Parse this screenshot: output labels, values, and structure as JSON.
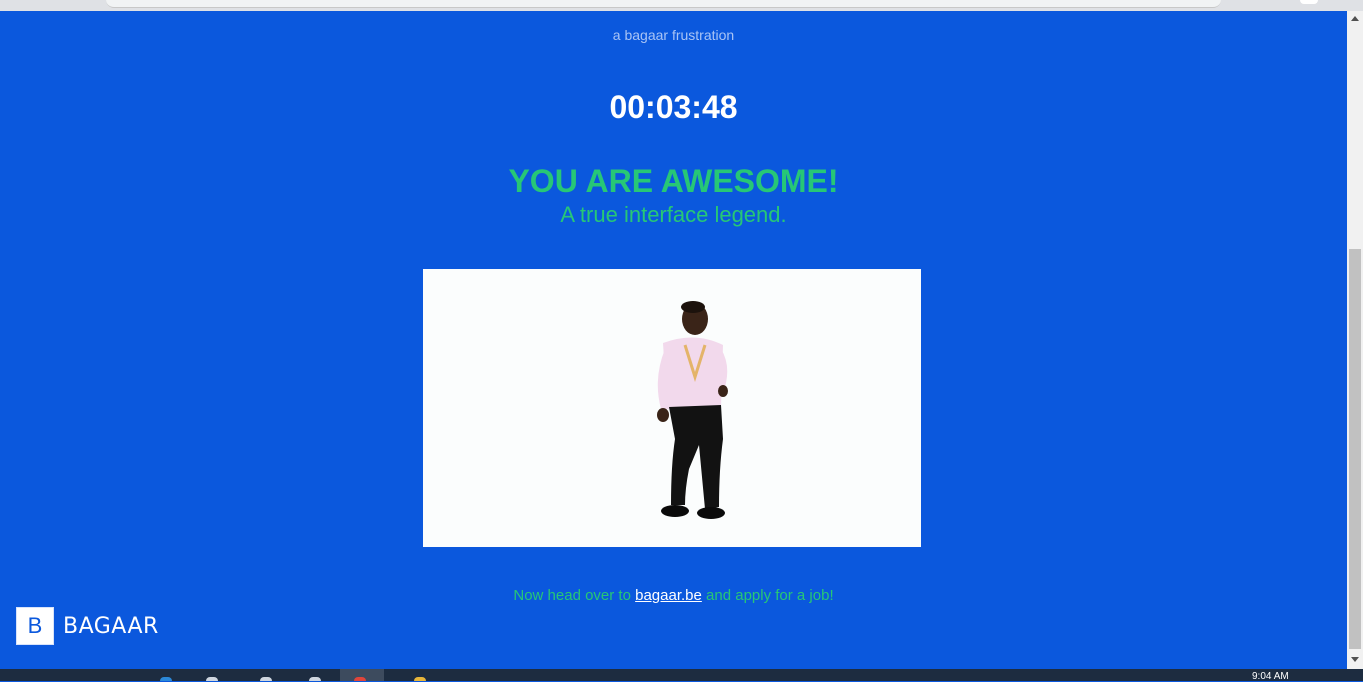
{
  "page": {
    "subtitle": "a bagaar frustration",
    "timer": "00:03:48",
    "headline": "YOU ARE AWESOME!",
    "tagline": "A true interface legend.",
    "footer": {
      "before": "Now head over to ",
      "link": "bagaar.be",
      "after": " and apply for a job!"
    },
    "logo": {
      "letter": "B",
      "word": "BAGAAR"
    }
  },
  "taskbar": {
    "clock": "9:04 AM"
  },
  "colors": {
    "background": "#0b58dd",
    "accent_green": "#27c776",
    "timer_white": "#ffffff"
  },
  "icons": {
    "gif": "dancing-man-gif",
    "scroll_up": "chevron-up-icon",
    "scroll_down": "chevron-down-icon"
  }
}
